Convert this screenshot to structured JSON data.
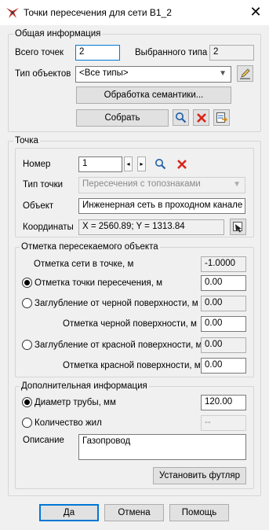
{
  "window": {
    "title": "Точки пересечения для сети В1_2",
    "close_symbol": "✕"
  },
  "general": {
    "legend": "Общая информация",
    "total_points_label": "Всего точек",
    "total_points_value": "2",
    "selected_type_label": "Выбранного типа",
    "selected_type_value": "2",
    "object_type_label": "Тип объектов",
    "object_type_value": "<Все типы>",
    "semantics_button": "Обработка семантики...",
    "collect_button": "Собрать"
  },
  "point": {
    "legend": "Точка",
    "number_label": "Номер",
    "number_value": "1",
    "prev_symbol": "◂",
    "next_symbol": "▸",
    "point_type_label": "Тип точки",
    "point_type_value": "Пересечения с топознаками",
    "object_label": "Объект",
    "object_value": "Инженерная сеть в проходном канале",
    "coords_label": "Координаты",
    "coords_value": "X = 2560.89; Y = 1313.84"
  },
  "crossed": {
    "legend": "Отметка пересекаемого объекта",
    "net_mark_label": "Отметка сети в точке, м",
    "net_mark_value": "-1.0000",
    "crossing_mark_label": "Отметка точки пересечения, м",
    "crossing_mark_value": "0.00",
    "black_depth_label": "Заглубление от черной поверхности, м",
    "black_depth_value": "0.00",
    "black_mark_label": "Отметка черной поверхности, м",
    "black_mark_value": "0.00",
    "red_depth_label": "Заглубление от красной поверхности, м",
    "red_depth_value": "0.00",
    "red_mark_label": "Отметка красной поверхности, м",
    "red_mark_value": "0.00"
  },
  "extra": {
    "legend": "Дополнительная информация",
    "diameter_label": "Диаметр трубы, мм",
    "diameter_value": "120.00",
    "cores_label": "Количество жил",
    "cores_value": "--",
    "description_label": "Описание",
    "description_value": "Газопровод",
    "casing_button": "Установить футляр"
  },
  "footer": {
    "ok": "Да",
    "cancel": "Отмена",
    "help": "Помощь"
  },
  "colors": {
    "accent": "#0078d7",
    "delete_red": "#d9261c",
    "window_bg": "#f0f0f0"
  },
  "icons": [
    "app-logo-icon",
    "pencil-icon",
    "search-icon",
    "delete-icon",
    "export-icon",
    "pick-point-icon"
  ]
}
